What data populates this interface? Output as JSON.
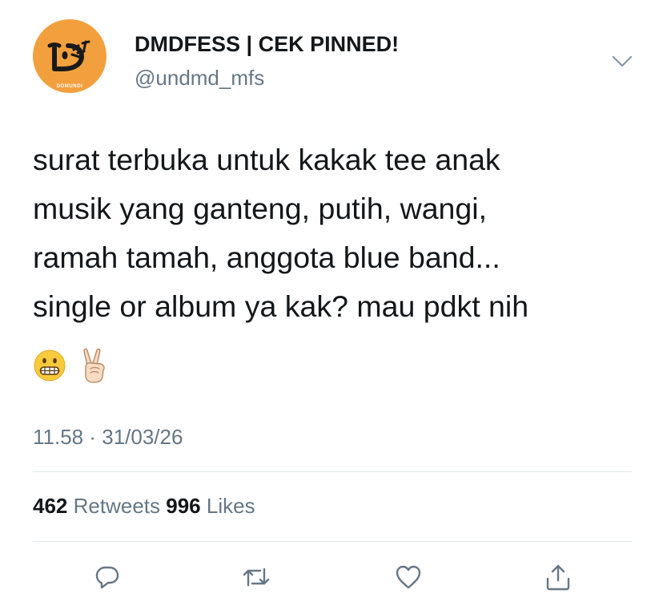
{
  "tweet": {
    "display_name": "DMDFESS | CEK PINNED!",
    "handle": "@undmd_mfs",
    "avatar": {
      "label": "DOMUNDI",
      "background": "#f2a03d"
    },
    "text_lines": [
      "surat terbuka untuk kakak tee anak",
      "musik yang ganteng, putih, wangi,",
      "ramah tamah, anggota blue band...",
      "single or album ya kak? mau pdkt nih"
    ],
    "emojis": [
      "grimacing-face",
      "victory-hand"
    ],
    "timestamp": "11.58 · 31/03/26",
    "stats": {
      "retweets_count": "462",
      "retweets_label": "Retweets",
      "likes_count": "996",
      "likes_label": "Likes"
    },
    "actions": [
      "reply-icon",
      "retweet-icon",
      "like-icon",
      "share-icon"
    ]
  },
  "colors": {
    "text": "#14171a",
    "secondary": "#657786",
    "divider": "#e1e8ed"
  }
}
